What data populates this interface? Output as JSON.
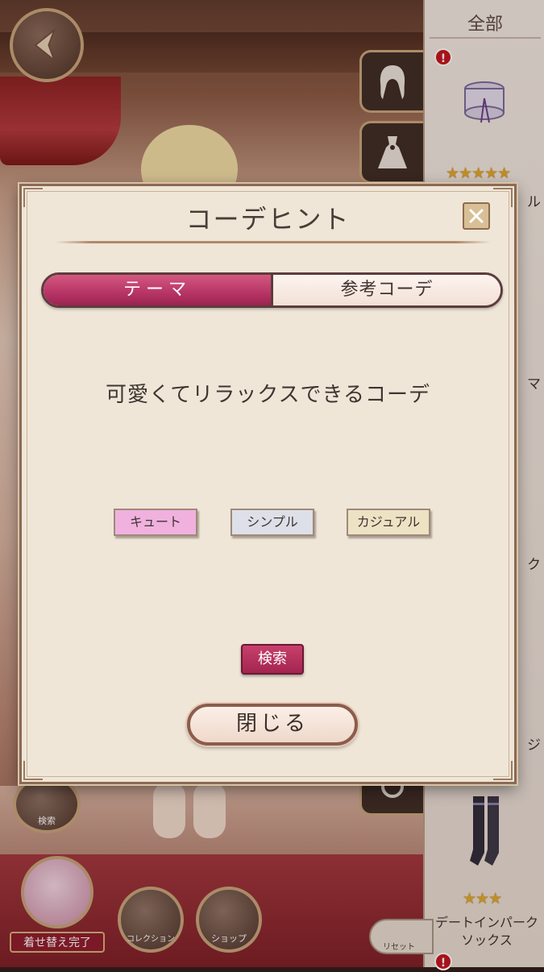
{
  "right_panel": {
    "header": "全部",
    "badge": "!",
    "item1_stars": "★★★★★",
    "item2_stars": "★★★",
    "item2_name": "デートインパーク\nソックス",
    "edge_chars": [
      "ル",
      "マ",
      "ク",
      "ジ"
    ]
  },
  "left_controls": {
    "search_label": "検索",
    "finish_label": "着せ替え完了",
    "collection_label": "コレクション",
    "shop_label": "ショップ",
    "reset_label": "リセット"
  },
  "modal": {
    "title": "コーデヒント",
    "tabs": [
      {
        "label": "テーマ",
        "active": true
      },
      {
        "label": "参考コーデ",
        "active": false
      }
    ],
    "theme_text": "可愛くてリラックスできるコーデ",
    "tags": [
      {
        "label": "キュート",
        "color": "#f0b1de"
      },
      {
        "label": "シンプル",
        "color": "#dde0e8"
      },
      {
        "label": "カジュアル",
        "color": "#ede2c4"
      }
    ],
    "search_button": "検索",
    "close_button": "閉じる"
  },
  "colors": {
    "accent_pink": "#b63466",
    "frame_brown": "#8b6a55",
    "modal_bg": "#efe6d8"
  }
}
